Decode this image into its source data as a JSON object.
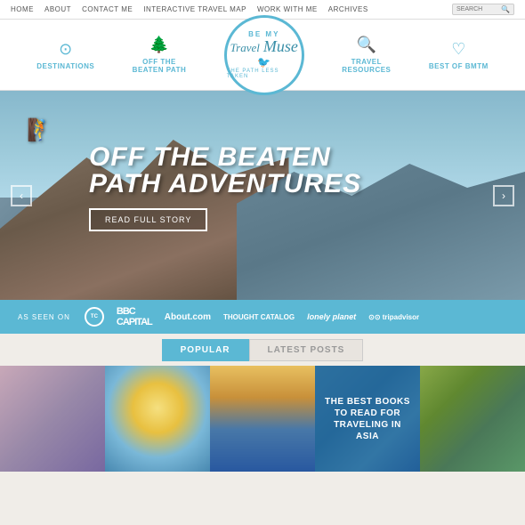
{
  "topnav": {
    "links": [
      "HOME",
      "ABOUT",
      "CONTACT ME",
      "INTERACTIVE TRAVEL MAP",
      "WORK WITH ME",
      "ARCHIVES"
    ],
    "search_placeholder": "SEARCH"
  },
  "mainnav": {
    "logo": {
      "top_text": "BE MY",
      "main_line1": "Travel",
      "main_line2": "Muse",
      "sub_text": "THE PATH LESS TAKEN"
    },
    "items": [
      {
        "id": "destinations",
        "label": "DESTINATIONS",
        "icon": "⊙"
      },
      {
        "id": "off-beaten",
        "label": "OFF THE\nBEATEN PATH",
        "icon": "🌲"
      },
      {
        "id": "travel-resources",
        "label": "TRAVEL\nRESOURCES",
        "icon": "🔍"
      },
      {
        "id": "best-of-bmtm",
        "label": "BEST OF BMTM",
        "icon": "♡"
      }
    ]
  },
  "hero": {
    "title_line1": "OFF THE BEATEN",
    "title_line2": "PATH ADVENTURES",
    "read_full_story": "READ FULL STORY"
  },
  "as_seen_on": {
    "label": "AS SEEN ON",
    "brands": [
      "TC",
      "BBC CAPITAL",
      "About.com",
      "THOUGHT CATALOG",
      "lonely planet",
      "⊙⊙ tripadvisor"
    ]
  },
  "tabs": {
    "popular": "POPULAR",
    "latest": "LATEST POSTS"
  },
  "thumbnails": [
    {
      "id": 1,
      "has_overlay": false
    },
    {
      "id": 2,
      "has_overlay": false
    },
    {
      "id": 3,
      "has_overlay": false
    },
    {
      "id": 4,
      "has_overlay": true,
      "text": "THE BEST BOOKS TO READ FOR TRAVELING IN ASIA"
    },
    {
      "id": 5,
      "has_overlay": false
    }
  ]
}
